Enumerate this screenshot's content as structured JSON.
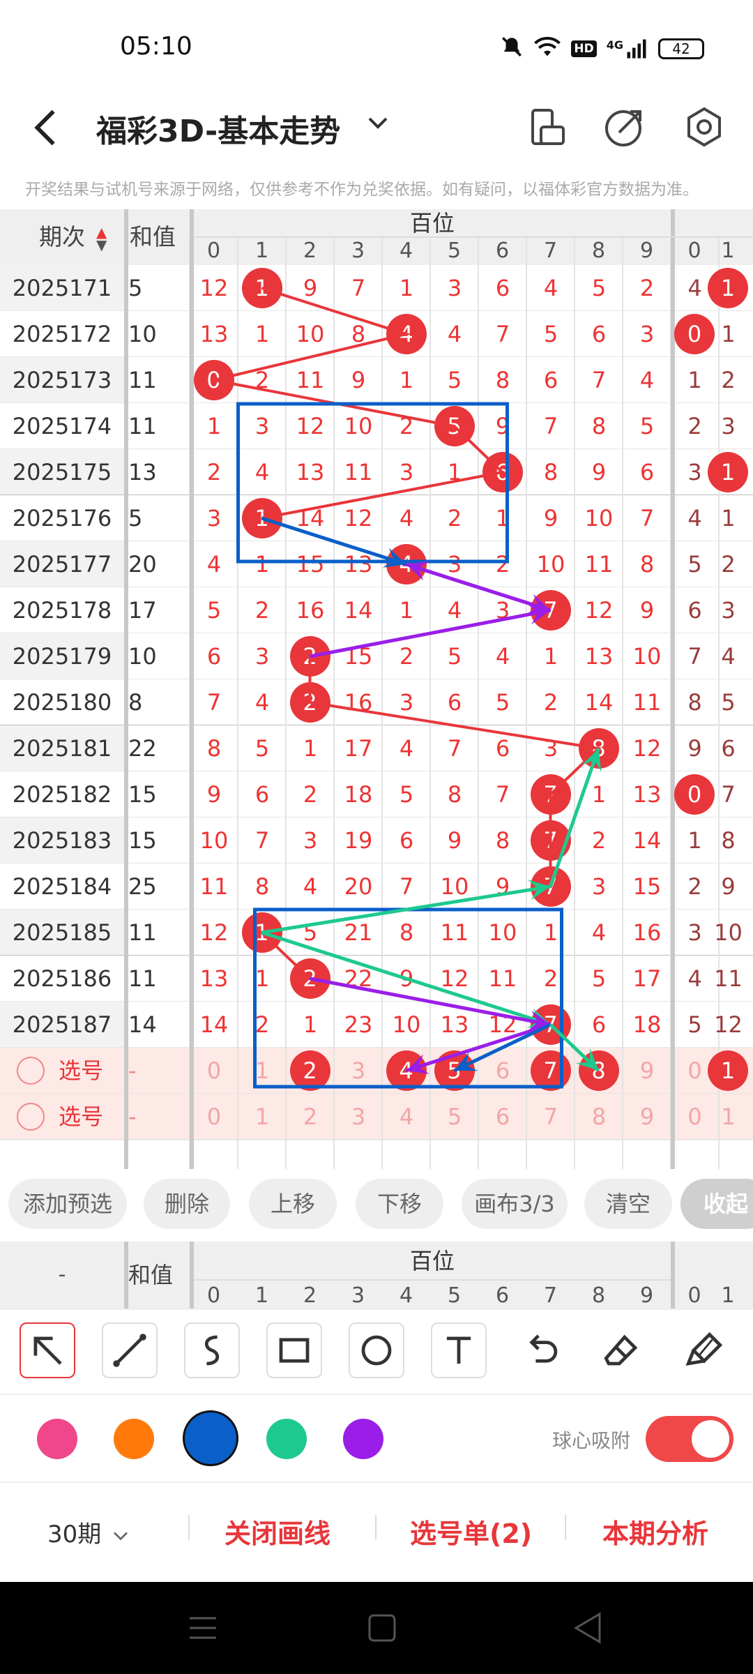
{
  "status": {
    "time": "05:10",
    "battery": "42",
    "hd": "HD",
    "net": "4G"
  },
  "header": {
    "title": "福彩3D-基本走势",
    "notice": "开奖结果与试机号来源于网络，仅供参考不作为兑奖依据。如有疑问，以福体彩官方数据为准。"
  },
  "table": {
    "col_period": "期次",
    "col_sum": "和值",
    "group_title": "百位",
    "digits": [
      "0",
      "1",
      "2",
      "3",
      "4",
      "5",
      "6",
      "7",
      "8",
      "9",
      "0",
      "1"
    ],
    "rows": [
      {
        "period": "2025171",
        "sum": "5",
        "cells": [
          "12",
          "1",
          "9",
          "7",
          "1",
          "3",
          "6",
          "4",
          "5",
          "2",
          "4",
          "1"
        ],
        "hit": 1,
        "hit2": 11
      },
      {
        "period": "2025172",
        "sum": "10",
        "cells": [
          "13",
          "1",
          "10",
          "8",
          "4",
          "4",
          "7",
          "5",
          "6",
          "3",
          "0",
          "1"
        ],
        "hit": 4,
        "hit2": 10
      },
      {
        "period": "2025173",
        "sum": "11",
        "cells": [
          "0",
          "2",
          "11",
          "9",
          "1",
          "5",
          "8",
          "6",
          "7",
          "4",
          "1",
          "2"
        ],
        "hit": 0,
        "hit2": -1
      },
      {
        "period": "2025174",
        "sum": "11",
        "cells": [
          "1",
          "3",
          "12",
          "10",
          "2",
          "5",
          "9",
          "7",
          "8",
          "5",
          "2",
          "3"
        ],
        "hit": 5,
        "hit2": -1
      },
      {
        "period": "2025175",
        "sum": "13",
        "cells": [
          "2",
          "4",
          "13",
          "11",
          "3",
          "1",
          "6",
          "8",
          "9",
          "6",
          "3",
          "1"
        ],
        "hit": 6,
        "hit2": 11
      },
      {
        "period": "2025176",
        "sum": "5",
        "cells": [
          "3",
          "1",
          "14",
          "12",
          "4",
          "2",
          "1",
          "9",
          "10",
          "7",
          "4",
          "1"
        ],
        "hit": 1,
        "hit2": -1
      },
      {
        "period": "2025177",
        "sum": "20",
        "cells": [
          "4",
          "1",
          "15",
          "13",
          "4",
          "3",
          "2",
          "10",
          "11",
          "8",
          "5",
          "2"
        ],
        "hit": 4,
        "hit2": -1
      },
      {
        "period": "2025178",
        "sum": "17",
        "cells": [
          "5",
          "2",
          "16",
          "14",
          "1",
          "4",
          "3",
          "7",
          "12",
          "9",
          "6",
          "3"
        ],
        "hit": 7,
        "hit2": -1
      },
      {
        "period": "2025179",
        "sum": "10",
        "cells": [
          "6",
          "3",
          "2",
          "15",
          "2",
          "5",
          "4",
          "1",
          "13",
          "10",
          "7",
          "4"
        ],
        "hit": 2,
        "hit2": -1
      },
      {
        "period": "2025180",
        "sum": "8",
        "cells": [
          "7",
          "4",
          "2",
          "16",
          "3",
          "6",
          "5",
          "2",
          "14",
          "11",
          "8",
          "5"
        ],
        "hit": 2,
        "hit2": -1
      },
      {
        "period": "2025181",
        "sum": "22",
        "cells": [
          "8",
          "5",
          "1",
          "17",
          "4",
          "7",
          "6",
          "3",
          "8",
          "12",
          "9",
          "6"
        ],
        "hit": 8,
        "hit2": -1
      },
      {
        "period": "2025182",
        "sum": "15",
        "cells": [
          "9",
          "6",
          "2",
          "18",
          "5",
          "8",
          "7",
          "7",
          "1",
          "13",
          "0",
          "7"
        ],
        "hit": 7,
        "hit2": 10
      },
      {
        "period": "2025183",
        "sum": "15",
        "cells": [
          "10",
          "7",
          "3",
          "19",
          "6",
          "9",
          "8",
          "7",
          "2",
          "14",
          "1",
          "8"
        ],
        "hit": 7,
        "hit2": -1
      },
      {
        "period": "2025184",
        "sum": "25",
        "cells": [
          "11",
          "8",
          "4",
          "20",
          "7",
          "10",
          "9",
          "7",
          "3",
          "15",
          "2",
          "9"
        ],
        "hit": 7,
        "hit2": -1
      },
      {
        "period": "2025185",
        "sum": "11",
        "cells": [
          "12",
          "1",
          "5",
          "21",
          "8",
          "11",
          "10",
          "1",
          "4",
          "16",
          "3",
          "10"
        ],
        "hit": 1,
        "hit2": -1
      },
      {
        "period": "2025186",
        "sum": "11",
        "cells": [
          "13",
          "1",
          "2",
          "22",
          "9",
          "12",
          "11",
          "2",
          "5",
          "17",
          "4",
          "11"
        ],
        "hit": 2,
        "hit2": -1
      },
      {
        "period": "2025187",
        "sum": "14",
        "cells": [
          "14",
          "2",
          "1",
          "23",
          "10",
          "13",
          "12",
          "7",
          "6",
          "18",
          "5",
          "12"
        ],
        "hit": 7,
        "hit2": -1
      }
    ],
    "pick_rows": [
      {
        "label": "选号",
        "sum": "-",
        "cells": [
          "0",
          "1",
          "2",
          "3",
          "4",
          "5",
          "6",
          "7",
          "8",
          "9",
          "0",
          "1"
        ],
        "balls": [
          2,
          4,
          5,
          7,
          8,
          11
        ]
      },
      {
        "label": "选号",
        "sum": "-",
        "cells": [
          "0",
          "1",
          "2",
          "3",
          "4",
          "5",
          "6",
          "7",
          "8",
          "9",
          "0",
          "1"
        ],
        "balls": []
      }
    ]
  },
  "actions": [
    "添加预选",
    "删除",
    "上移",
    "下移",
    "画布3/3",
    "清空",
    "收起"
  ],
  "table2": {
    "col_period": "-",
    "col_sum": "和值",
    "group_title": "百位"
  },
  "tools": [
    "arrow-select",
    "line",
    "curve",
    "rectangle",
    "circle",
    "text",
    "undo",
    "eraser",
    "clear-brush"
  ],
  "colors": [
    "#f0468c",
    "#ff7a0a",
    "#0a5fc8",
    "#1dc98f",
    "#9a1ee8"
  ],
  "snap_label": "球心吸附",
  "bottom": {
    "periods": "30期",
    "close_draw": "关闭画线",
    "pick_list": "选号单(2)",
    "analysis": "本期分析"
  }
}
